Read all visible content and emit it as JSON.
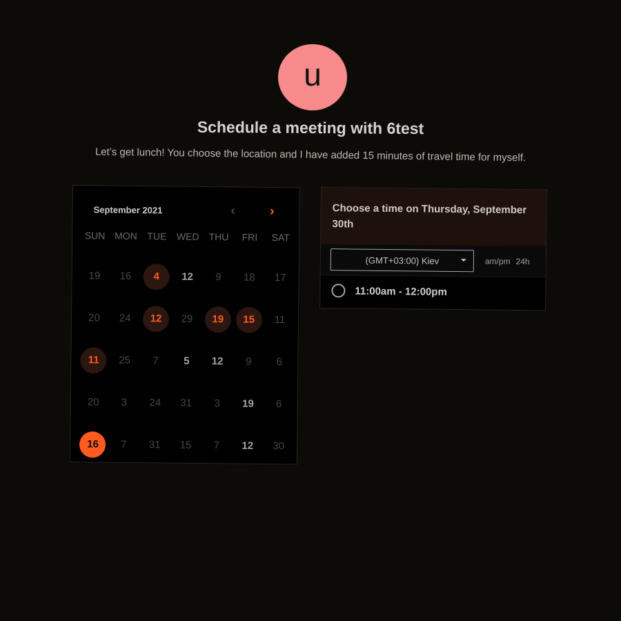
{
  "avatar": {
    "letter": "u",
    "color": "#f78a8a"
  },
  "title": "Schedule a meeting with 6test",
  "subtitle": "Let’s get lunch! You choose the location and I have added 15 minutes of travel time for myself.",
  "calendar": {
    "month_label": "September 2021",
    "prev_icon": "chevron-left-icon",
    "next_icon": "chevron-right-icon",
    "weekdays": [
      "SUN",
      "MON",
      "TUE",
      "WED",
      "THU",
      "FRI",
      "SAT"
    ],
    "days": [
      {
        "n": "19",
        "state": "dim"
      },
      {
        "n": "16",
        "state": "dim"
      },
      {
        "n": "4",
        "state": "available"
      },
      {
        "n": "12",
        "state": "bright"
      },
      {
        "n": "9",
        "state": "dim"
      },
      {
        "n": "18",
        "state": "dim"
      },
      {
        "n": "17",
        "state": "dim"
      },
      {
        "n": "20",
        "state": "dim"
      },
      {
        "n": "24",
        "state": "dim"
      },
      {
        "n": "12",
        "state": "available"
      },
      {
        "n": "29",
        "state": "dim"
      },
      {
        "n": "19",
        "state": "available"
      },
      {
        "n": "15",
        "state": "available"
      },
      {
        "n": "11",
        "state": "dim"
      },
      {
        "n": "11",
        "state": "available"
      },
      {
        "n": "25",
        "state": "dim"
      },
      {
        "n": "7",
        "state": "dim"
      },
      {
        "n": "5",
        "state": "bright"
      },
      {
        "n": "12",
        "state": "bright"
      },
      {
        "n": "9",
        "state": "dim"
      },
      {
        "n": "6",
        "state": "dim"
      },
      {
        "n": "20",
        "state": "dim"
      },
      {
        "n": "3",
        "state": "dim"
      },
      {
        "n": "24",
        "state": "dim"
      },
      {
        "n": "31",
        "state": "dim"
      },
      {
        "n": "3",
        "state": "dim"
      },
      {
        "n": "19",
        "state": "bright"
      },
      {
        "n": "6",
        "state": "dim"
      },
      {
        "n": "16",
        "state": "selected"
      },
      {
        "n": "7",
        "state": "dim"
      },
      {
        "n": "31",
        "state": "dim"
      },
      {
        "n": "15",
        "state": "dim"
      },
      {
        "n": "7",
        "state": "dim"
      },
      {
        "n": "12",
        "state": "bright"
      },
      {
        "n": "30",
        "state": "dim"
      }
    ]
  },
  "time_panel": {
    "heading": "Choose a time on Thursday, September 30th",
    "timezone": "(GMT+03:00) Kiev",
    "format_ampm": "am/pm",
    "format_24h": "24h",
    "slots": [
      "11:00am - 12:00pm"
    ]
  },
  "colors": {
    "accent": "#ff5a1f",
    "background": "#0d0b08",
    "available_bg": "#2b1610"
  }
}
